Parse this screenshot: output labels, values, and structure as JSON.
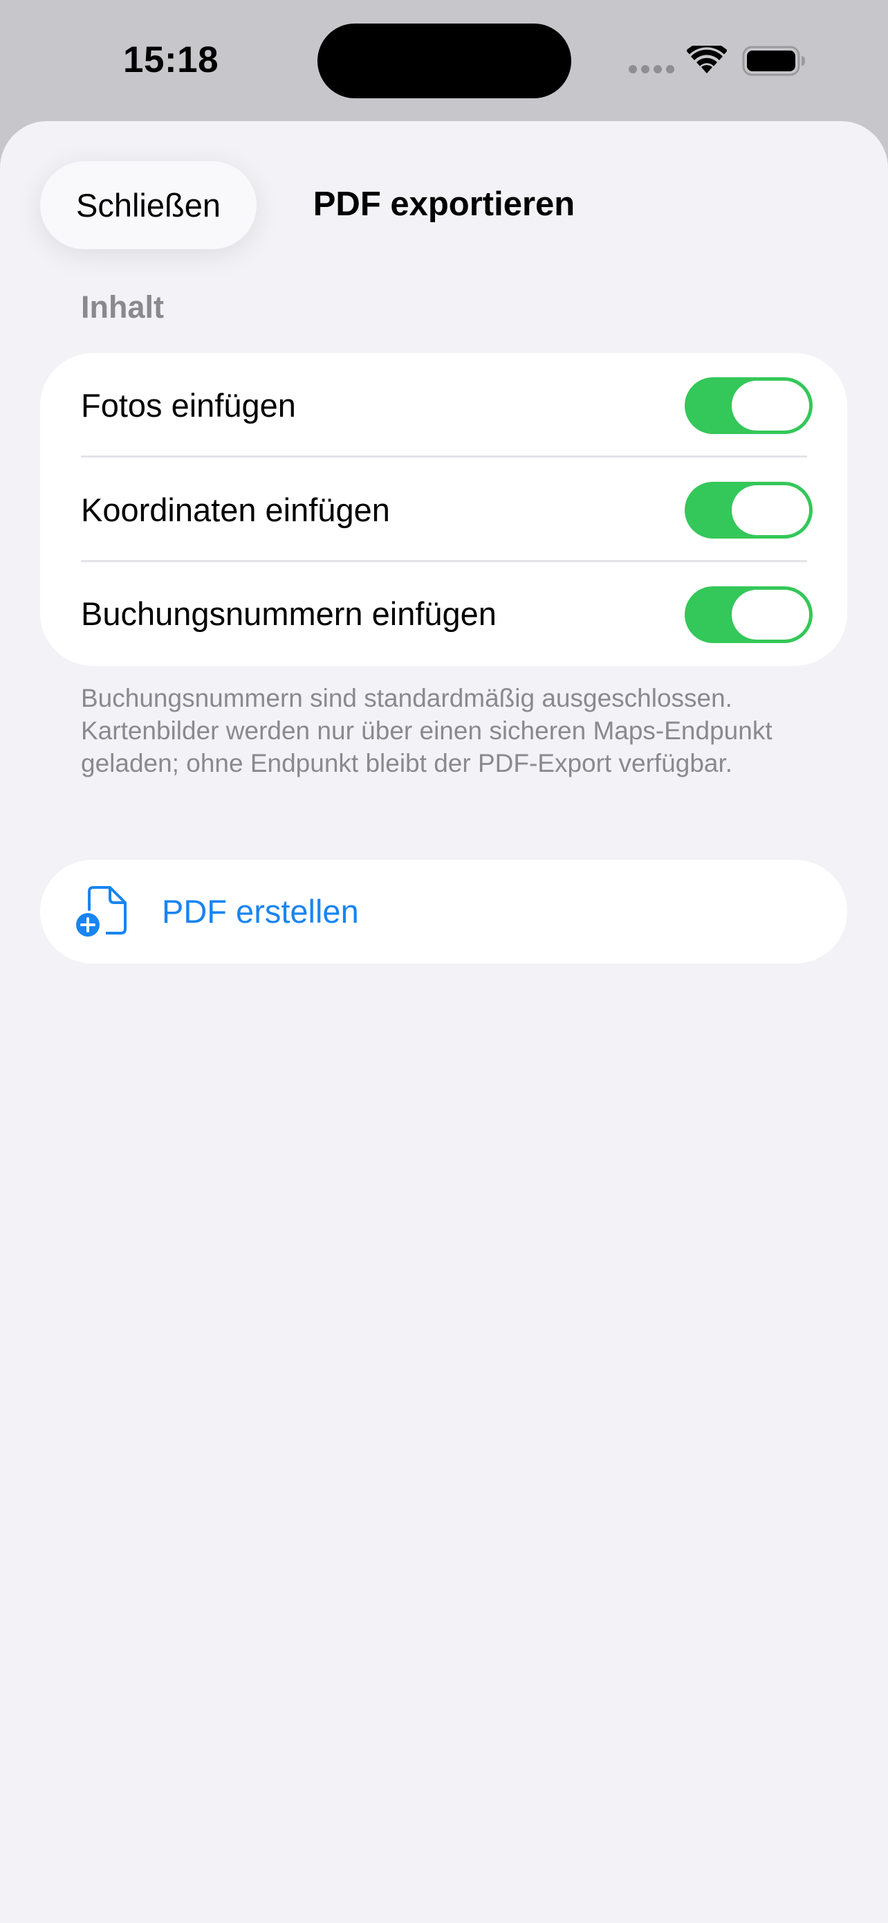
{
  "status_bar": {
    "time": "15:18"
  },
  "sheet": {
    "close_label": "Schließen",
    "title": "PDF exportieren"
  },
  "content_section": {
    "header": "Inhalt",
    "toggles": [
      {
        "label": "Fotos einfügen",
        "on": true
      },
      {
        "label": "Koordinaten einfügen",
        "on": true
      },
      {
        "label": "Buchungsnummern einfügen",
        "on": true
      }
    ],
    "footer": "Buchungsnummern sind standardmäßig ausgeschlossen. Kartenbilder werden nur über einen sicheren Maps-Endpunkt geladen; ohne Endpunkt bleibt der PDF-Export verfügbar."
  },
  "action": {
    "label": "PDF erstellen",
    "icon": "document-badge-plus-icon"
  },
  "colors": {
    "accent": "#1a84f0",
    "toggle_on": "#34c759",
    "background": "#f2f2f7"
  }
}
